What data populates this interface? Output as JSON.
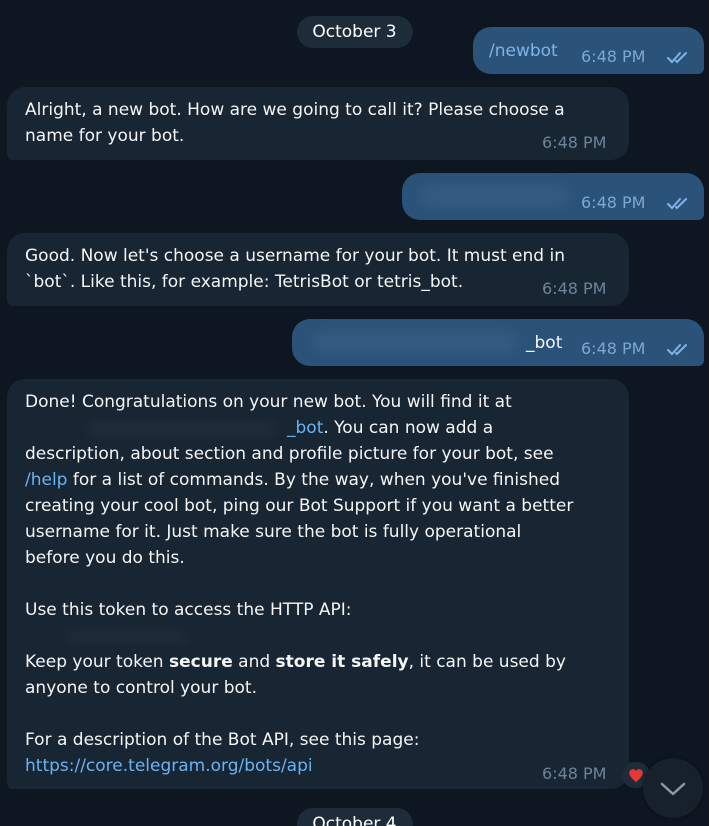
{
  "dates": {
    "first": "October 3",
    "second": "October 4"
  },
  "messages": {
    "m1": {
      "text": "/newbot",
      "time": "6:48 PM",
      "status": "read"
    },
    "m2": {
      "line1": "Alright, a new bot. How are we going to call it? Please choose a",
      "line2": "name for your bot.",
      "time": "6:48 PM"
    },
    "m3": {
      "time": "6:48 PM",
      "status": "read"
    },
    "m4": {
      "line1": "Good. Now let's choose a username for your bot. It must end in",
      "line2": "`bot`. Like this, for example: TetrisBot or tetris_bot.",
      "time": "6:48 PM"
    },
    "m5": {
      "suffix": "_bot",
      "time": "6:48 PM",
      "status": "read"
    },
    "m6": {
      "l1": "Done! Congratulations on your new bot. You will find it at",
      "l2_link": "_bot",
      "l2_rest": ". You can now add a",
      "l3": "description, about section and profile picture for your bot, see",
      "l4_link": "/help",
      "l4_rest": " for a list of commands. By the way, when you've finished",
      "l5": "creating your cool bot, ping our Bot Support if you want a better",
      "l6": "username for it. Just make sure the bot is fully operational",
      "l7": "before you do this.",
      "l8": "Use this token to access the HTTP API:",
      "l9_pre": "Keep your token ",
      "l9_b1": "secure",
      "l9_mid": " and ",
      "l9_b2": "store it safely",
      "l9_post": ", it can be used by",
      "l10": "anyone to control your bot.",
      "l11": "For a description of the Bot API, see this page:",
      "l12_link": "https://core.telegram.org/bots/api",
      "time": "6:48 PM",
      "reaction": "heart-icon"
    }
  },
  "colors": {
    "background": "#0e1621",
    "incoming_bubble": "#182533",
    "outgoing_bubble": "#2b5278",
    "link": "#6ab3f3"
  }
}
